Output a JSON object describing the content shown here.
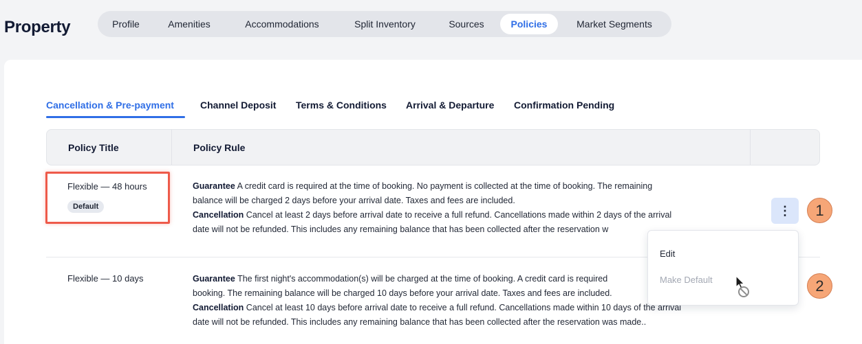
{
  "page": {
    "title": "Property"
  },
  "top_tabs": [
    {
      "label": "Profile",
      "active": false
    },
    {
      "label": "Amenities",
      "active": false
    },
    {
      "label": "Accommodations",
      "active": false
    },
    {
      "label": "Split Inventory",
      "active": false
    },
    {
      "label": "Sources",
      "active": false
    },
    {
      "label": "Policies",
      "active": true
    },
    {
      "label": "Market Segments",
      "active": false
    }
  ],
  "sub_tabs": [
    {
      "label": "Cancellation & Pre-payment",
      "active": true
    },
    {
      "label": "Channel Deposit",
      "active": false
    },
    {
      "label": "Terms & Conditions",
      "active": false
    },
    {
      "label": "Arrival & Departure",
      "active": false
    },
    {
      "label": "Confirmation Pending",
      "active": false
    }
  ],
  "table": {
    "headers": {
      "title": "Policy Title",
      "rule": "Policy Rule"
    },
    "rows": [
      {
        "title": "Flexible — 48 hours",
        "badge": "Default",
        "guarantee_label": "Guarantee",
        "guarantee_text_1": " A credit card is required at the time of booking. No payment is collected at the time of booking. The remaining",
        "guarantee_text_2": "balance will be charged 2 days before your arrival date. Taxes and fees are included.",
        "cancellation_label": "Cancellation",
        "cancellation_text_1": " Cancel at least 2 days before arrival date to receive a full refund. Cancellations made within 2 days of the arrival",
        "cancellation_text_2": "date will not be refunded. This includes any remaining balance that has been collected after the reservation w"
      },
      {
        "title": "Flexible — 10 days",
        "guarantee_label": "Guarantee",
        "guarantee_text_1": " The first night's accommodation(s) will be charged at the time of booking. A credit card is required",
        "guarantee_text_2": "booking. The remaining balance will be charged 10 days before your arrival date. Taxes and fees are included.",
        "cancellation_label": "Cancellation",
        "cancellation_text_1": " Cancel at least 10 days before arrival date to receive a full refund. Cancellations made within 10 days of the arrival",
        "cancellation_text_2": "date will not be refunded. This includes any remaining balance that has been collected after the reservation was made.."
      }
    ]
  },
  "row_menu": {
    "kebab_icon": "⋮",
    "items": [
      {
        "label": "Edit",
        "enabled": true
      },
      {
        "label": "Make Default",
        "enabled": false
      }
    ]
  },
  "step_markers": [
    "1",
    "2"
  ],
  "colors": {
    "accent": "#2f6ee6",
    "highlight": "#ee5a4a",
    "step_marker": "#f6a677"
  }
}
